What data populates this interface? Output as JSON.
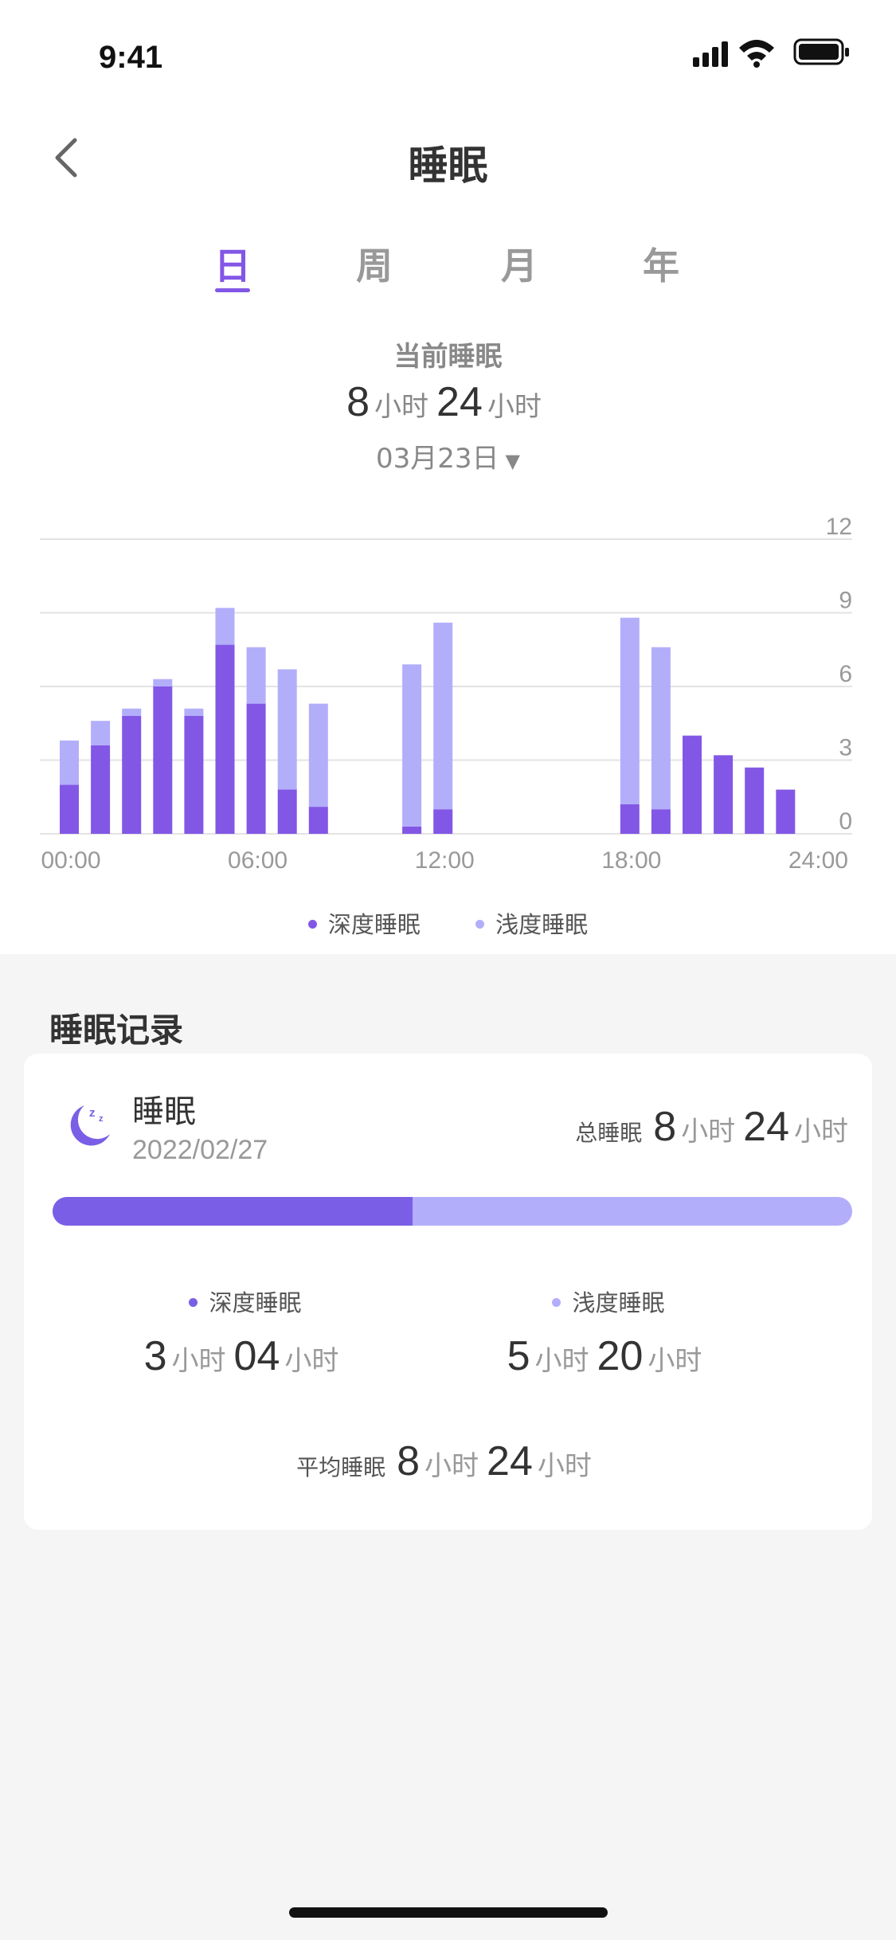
{
  "status_bar": {
    "time": "9:41"
  },
  "header": {
    "title": "睡眠"
  },
  "tabs": [
    {
      "label": "日",
      "active": true
    },
    {
      "label": "周",
      "active": false
    },
    {
      "label": "月",
      "active": false
    },
    {
      "label": "年",
      "active": false
    }
  ],
  "summary": {
    "label": "当前睡眠",
    "hours": "8",
    "hours_unit": "小时",
    "minutes": "24",
    "minutes_unit": "小时",
    "date": "03月23日",
    "date_arrow": "▼"
  },
  "colors": {
    "deep": "#8257e6",
    "light": "#b3aefa",
    "accent": "#8257e6"
  },
  "chart_data": {
    "type": "bar",
    "stacked": true,
    "x_tick_labels": [
      "00:00",
      "06:00",
      "12:00",
      "18:00",
      "24:00"
    ],
    "y_tick_labels": [
      "12",
      "9",
      "6",
      "3",
      "0"
    ],
    "ylim": [
      0,
      12
    ],
    "grid": true,
    "legend_position": "bottom-center",
    "series": [
      {
        "name": "深度睡眠",
        "color": "#8257e6",
        "values": [
          2.0,
          3.6,
          4.8,
          6.0,
          4.8,
          7.7,
          5.3,
          1.8,
          1.1,
          0,
          0,
          0.3,
          1.0,
          0,
          0,
          0,
          0,
          0,
          1.2,
          1.0,
          4.0,
          3.2,
          2.7,
          1.8
        ]
      },
      {
        "name": "浅度睡眠",
        "color": "#b3aefa",
        "values": [
          1.8,
          1.0,
          0.3,
          0.3,
          0.3,
          1.5,
          2.3,
          4.9,
          4.2,
          0,
          0,
          6.6,
          7.6,
          0,
          0,
          0,
          0,
          0,
          7.6,
          6.6,
          0,
          0,
          0,
          0
        ]
      }
    ]
  },
  "legend": [
    {
      "label": "深度睡眠",
      "color": "#8257e6"
    },
    {
      "label": "浅度睡眠",
      "color": "#b3aefa"
    }
  ],
  "records": {
    "section_title": "睡眠记录",
    "item": {
      "title": "睡眠",
      "date": "2022/02/27",
      "total_label": "总睡眠",
      "total_hours": "8",
      "total_minutes": "24",
      "unit": "小时",
      "deep_fraction": 0.45,
      "deep": {
        "label": "深度睡眠",
        "hours": "3",
        "minutes": "04"
      },
      "light": {
        "label": "浅度睡眠",
        "hours": "5",
        "minutes": "20"
      },
      "avg_label": "平均睡眠",
      "avg_hours": "8",
      "avg_minutes": "24"
    }
  }
}
